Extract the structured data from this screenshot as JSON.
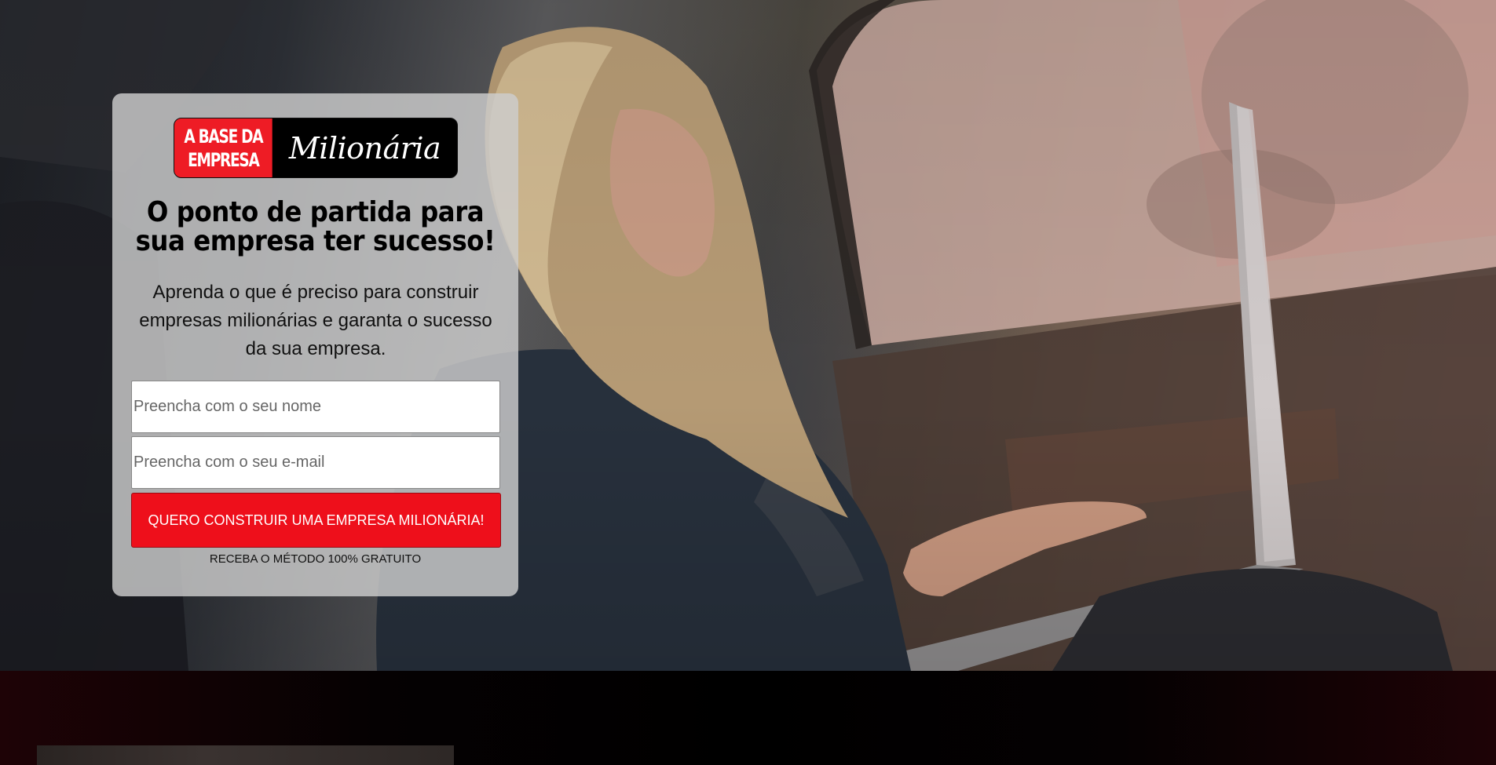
{
  "logo": {
    "line1": "A BASE DA",
    "line2": "EMPRESA",
    "script": "Milionária"
  },
  "headline": "O ponto de partida para sua empresa ter sucesso!",
  "subtext": "Aprenda o que é preciso para construir empresas milionárias e garanta o sucesso da sua empresa.",
  "form": {
    "name_placeholder": "Preencha com o seu nome",
    "email_placeholder": "Preencha com o seu e-mail",
    "submit_label": "QUERO CONSTRUIR UMA EMPRESA MILIONÁRIA!",
    "caption": "RECEBA O MÉTODO 100% GRATUITO"
  },
  "colors": {
    "brand_red": "#ee1c25",
    "cta_red": "#ee0f1b",
    "card_bg": "rgba(205,205,205,0.82)",
    "bottom_accent": "#1e0306"
  }
}
